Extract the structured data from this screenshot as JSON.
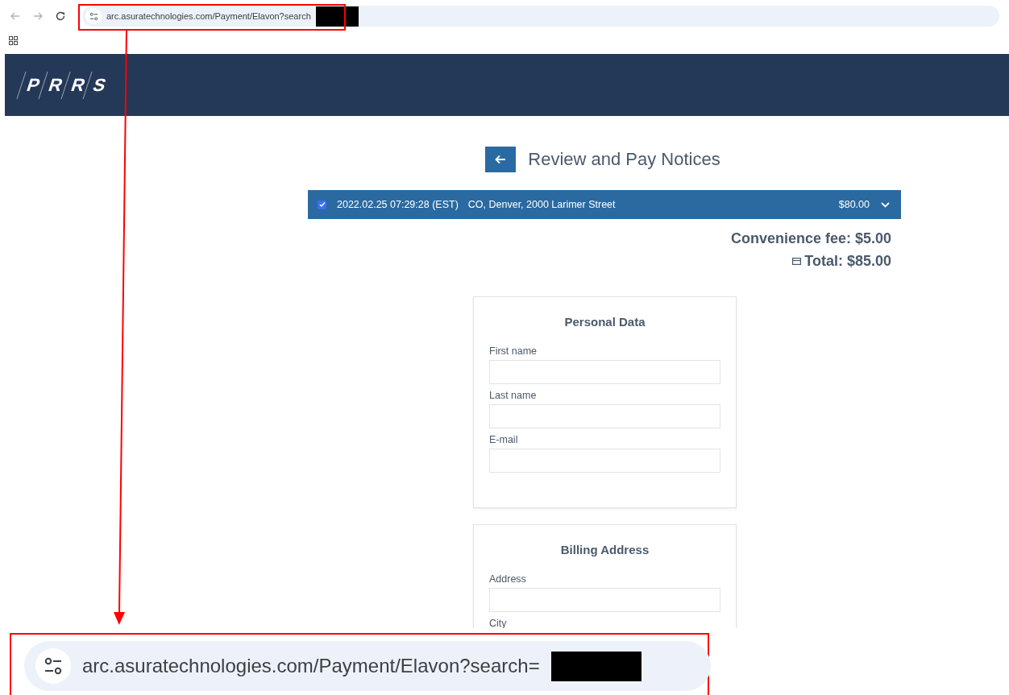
{
  "browser": {
    "nav": [
      {
        "kind": "back",
        "disabled": true
      },
      {
        "kind": "forward",
        "disabled": true
      },
      {
        "kind": "reload",
        "disabled": false
      }
    ],
    "url": "arc.asuratechnologies.com/Payment/Elavon?search"
  },
  "header": {
    "logo_letters": [
      "P",
      "R",
      "R",
      "S"
    ]
  },
  "page": {
    "title": "Review and Pay Notices",
    "notices": [
      {
        "checked": true,
        "datetime": "2022.02.25 07:29:28 (EST)",
        "location": "CO, Denver, 2000 Larimer Street",
        "amount": "$80.00"
      }
    ],
    "convenience_fee": "Convenience fee: $5.00",
    "total": "Total: $85.00",
    "sections": [
      {
        "title": "Personal Data",
        "fields": [
          {
            "label": "First name",
            "kind": "text"
          },
          {
            "label": "Last name",
            "kind": "text"
          },
          {
            "label": "E-mail",
            "kind": "text"
          }
        ]
      },
      {
        "title": "Billing Address",
        "fields": [
          {
            "label": "Address",
            "kind": "text"
          },
          {
            "label": "City",
            "kind": "label"
          }
        ]
      }
    ]
  },
  "callout": {
    "url": "arc.asuratechnologies.com/Payment/Elavon?search="
  }
}
